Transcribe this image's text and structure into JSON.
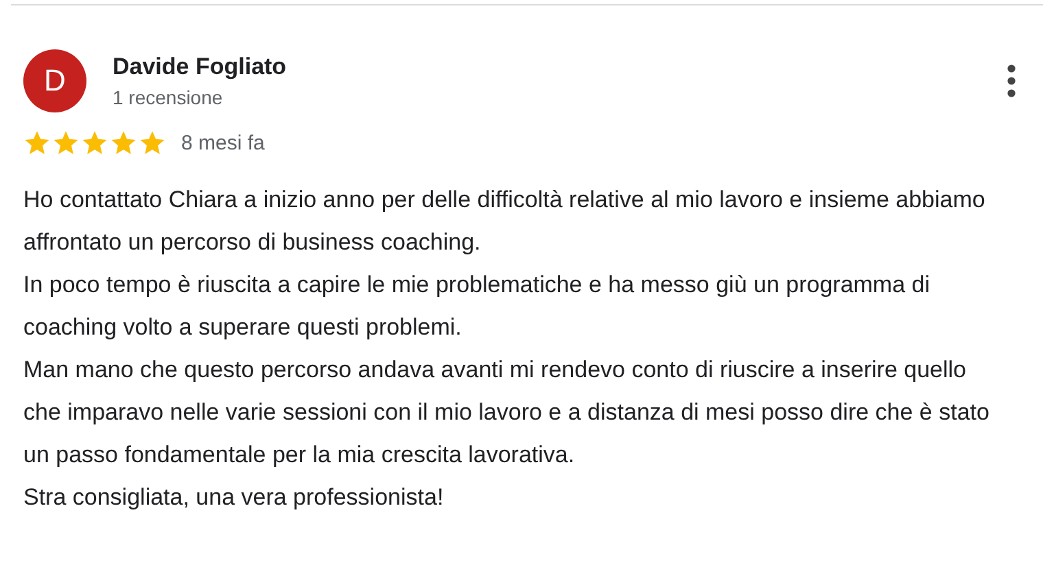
{
  "review": {
    "avatar_letter": "D",
    "author": "Davide Fogliato",
    "author_meta": "1 recensione",
    "stars": 5,
    "time": "8 mesi fa",
    "paragraphs": [
      "Ho contattato Chiara a inizio anno per delle difficoltà relative al mio lavoro e insieme abbiamo affrontato un percorso di business coaching.",
      "In poco tempo è riuscita a capire le mie problematiche e ha messo giù un programma di coaching volto a superare questi problemi.",
      "Man mano che questo percorso andava avanti mi rendevo conto di riuscire a inserire quello che imparavo nelle varie sessioni con il mio lavoro e a distanza di mesi posso dire che è stato un passo fondamentale per la mia crescita lavorativa.",
      "Stra consigliata, una vera professionista!"
    ]
  }
}
